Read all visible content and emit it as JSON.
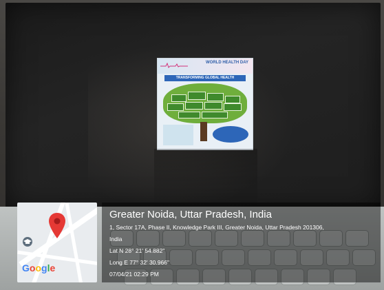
{
  "location": {
    "title": "Greater Noida, Uttar Pradesh, India",
    "address_line1": "1, Sector 17A, Phase II, Knowledge Park III, Greater Noida, Uttar Pradesh 201306,",
    "address_line2": "India",
    "latitude": "Lat N 28° 21' 54.882\"",
    "longitude": "Long E 77° 32' 30.966\"",
    "timestamp": "07/04/21 02:29 PM"
  },
  "map": {
    "brand": "Google",
    "pin_color": "#e53935",
    "icons": [
      "map-pin-icon",
      "education-icon"
    ]
  },
  "poster": {
    "title": "WORLD HEALTH DAY",
    "subtitle": "TRANSFORMING GLOBAL HEALTH"
  },
  "colors": {
    "overlay": "#000000",
    "poster_blue": "#2d66b8",
    "poster_green": "#6fae3c"
  }
}
